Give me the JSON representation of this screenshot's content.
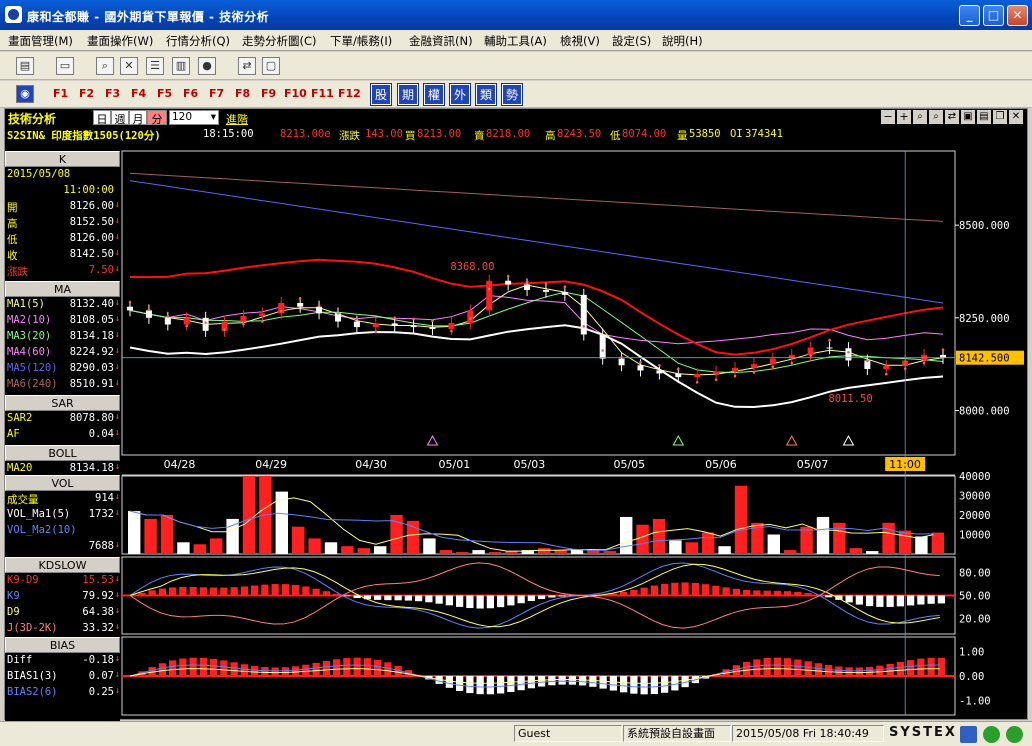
{
  "window": {
    "title": "康和全都賺 - 國外期貨下單報價 - 技術分析",
    "min_label": "_",
    "max_label": "□",
    "close_label": "✕"
  },
  "menu": [
    "畫面管理(M)",
    "畫面操作(W)",
    "行情分析(Q)",
    "走勢分析圖(C)",
    "下單/帳務(I)",
    "金融資訊(N)",
    "輔助工具(A)",
    "檢視(V)",
    "設定(S)",
    "說明(H)"
  ],
  "fkeys": [
    "F1",
    "F2",
    "F3",
    "F4",
    "F5",
    "F6",
    "F7",
    "F8",
    "F9",
    "F10",
    "F11",
    "F12"
  ],
  "quick": [
    "股",
    "期",
    "權",
    "外",
    "類",
    "勢"
  ],
  "chart_header": {
    "title": "技術分析",
    "period_tabs": [
      "日",
      "週",
      "月",
      "分"
    ],
    "period_value": "120",
    "advanced": "進階",
    "symbol": "S2SIN&  印度指數1505(120分)",
    "time": "18:15:00",
    "last": "8213.00e",
    "change_label": "漲跌",
    "change": "143.00",
    "bid_label": "買",
    "bid": "8213.00",
    "ask_label": "賣",
    "ask": "8218.00",
    "high_label": "高",
    "high": "8243.50",
    "low_label": "低",
    "low": "8074.00",
    "vol_label": "量",
    "vol": "53850",
    "oi_label": "OI",
    "oi": "374341"
  },
  "panel": {
    "k": {
      "label": "K",
      "date": "2015/05/08",
      "time": "11:00:00",
      "rows": [
        {
          "k": "開",
          "v": "8126.00",
          "c": "#ffff00"
        },
        {
          "k": "高",
          "v": "8152.50",
          "c": "#ffff00"
        },
        {
          "k": "低",
          "v": "8126.00",
          "c": "#ffff00"
        },
        {
          "k": "收",
          "v": "8142.50",
          "c": "#ffff00"
        },
        {
          "k": "漲跌",
          "v": "7.50",
          "c": "#ff3030"
        }
      ]
    },
    "ma": {
      "label": "MA",
      "rows": [
        {
          "k": "MA1(5)",
          "v": "8132.40",
          "c": "#ffff80"
        },
        {
          "k": "MA2(10)",
          "v": "8108.05",
          "c": "#ff80ff"
        },
        {
          "k": "MA3(20)",
          "v": "8134.18",
          "c": "#80ff80"
        },
        {
          "k": "MA4(60)",
          "v": "8224.92",
          "c": "#ff80ff"
        },
        {
          "k": "MA5(120)",
          "v": "8290.03",
          "c": "#6060ff"
        },
        {
          "k": "MA6(240)",
          "v": "8510.91",
          "c": "#b06060"
        }
      ]
    },
    "sar": {
      "label": "SAR",
      "rows": [
        {
          "k": "SAR2",
          "v": "8078.80",
          "c": "#ffff00"
        },
        {
          "k": "AF",
          "v": "0.04",
          "c": "#ffff00"
        }
      ]
    },
    "boll": {
      "label": "BOLL",
      "rows": [
        {
          "k": "MA20",
          "v": "8134.18",
          "c": "#ffff00"
        }
      ]
    },
    "vol": {
      "label": "VOL",
      "rows": [
        {
          "k": "成交量",
          "v": "914",
          "c": "#ffff00"
        },
        {
          "k": "VOL_Ma1(5)",
          "v": "1732",
          "c": "#ffffff"
        },
        {
          "k": "VOL_Ma2(10)",
          "v": "",
          "c": "#6080ff"
        },
        {
          "k": "",
          "v": "7688",
          "c": "#6080ff"
        }
      ]
    },
    "kd": {
      "label": "KDSLOW",
      "rows": [
        {
          "k": "K9-D9",
          "v": "15.53",
          "c": "#ff3030"
        },
        {
          "k": "K9",
          "v": "79.92",
          "c": "#6080ff"
        },
        {
          "k": "D9",
          "v": "64.38",
          "c": "#ffff60"
        },
        {
          "k": "J(3D-2K)",
          "v": "33.32",
          "c": "#ff8080"
        }
      ]
    },
    "bias": {
      "label": "BIAS",
      "rows": [
        {
          "k": "Diff",
          "v": "-0.18",
          "c": "#ffffff"
        },
        {
          "k": "BIAS1(3)",
          "v": "0.07",
          "c": "#ffffff"
        },
        {
          "k": "BIAS2(6)",
          "v": "0.25",
          "c": "#6080ff"
        }
      ]
    }
  },
  "chart_data": [
    {
      "type": "line",
      "panel": "price",
      "x": [
        "04/28",
        "04/29",
        "04/30",
        "05/01",
        "05/03",
        "05/05",
        "05/06",
        "05/07",
        "05/08 11:00"
      ],
      "yticks": [
        8000,
        8250,
        8500
      ],
      "ytick_labels": [
        "8000.000",
        "8250.000",
        "8500.000"
      ],
      "ylim": [
        7880,
        8700
      ],
      "last_price_label": "8142.500",
      "annotations": [
        {
          "text": "8368.00",
          "x_index": 18,
          "value": 8368
        },
        {
          "text": "8011.50",
          "x_index": 38,
          "value": 8011.5
        }
      ],
      "crosshair_label": "11:00",
      "candles_close": [
        8270,
        8250,
        8232,
        8250,
        8215,
        8240,
        8255,
        8262,
        8290,
        8280,
        8262,
        8240,
        8225,
        8235,
        8228,
        8225,
        8220,
        8236,
        8270,
        8350,
        8340,
        8325,
        8320,
        8312,
        8205,
        8140,
        8122,
        8108,
        8100,
        8090,
        8098,
        8105,
        8115,
        8125,
        8140,
        8150,
        8170,
        8168,
        8135,
        8112,
        8120,
        8135,
        8150,
        8142
      ],
      "series": [
        {
          "name": "MA6(240)",
          "values_start": 8640,
          "values_end": 8510
        },
        {
          "name": "MA5(120)",
          "values_start": 8620,
          "values_end": 8290
        },
        {
          "name": "MA4(60)",
          "values_start": 8270,
          "values_end": 8225
        },
        {
          "name": "BOLL",
          "values_start": 8420,
          "values_end": 8134
        }
      ]
    },
    {
      "type": "bar",
      "panel": "volume",
      "yticks": [
        10000,
        20000,
        30000,
        40000
      ],
      "ylim": [
        0,
        40000
      ],
      "values": [
        22000,
        18000,
        20000,
        6000,
        5000,
        8000,
        18000,
        40000,
        40000,
        32000,
        14000,
        8000,
        6000,
        4000,
        3000,
        4000,
        20000,
        17000,
        8000,
        2000,
        1000,
        2000,
        1000,
        1500,
        2000,
        3000,
        2000,
        2500,
        2000,
        1500,
        19000,
        15000,
        18000,
        7000,
        6000,
        11000,
        4000,
        35000,
        16000,
        10000,
        2000,
        14000,
        19000,
        16000,
        3000,
        1500,
        16000,
        12000,
        9000,
        11000
      ]
    },
    {
      "type": "bar",
      "panel": "kdslow",
      "yticks": [
        20,
        50,
        80
      ],
      "ylim": [
        0,
        100
      ]
    },
    {
      "type": "bar",
      "panel": "bias",
      "yticks": [
        -1.0,
        0.0,
        1.0
      ],
      "ylim": [
        -1.6,
        1.6
      ]
    }
  ],
  "status": {
    "user": "Guest",
    "layout": "系統預設自設畫面",
    "datetime": "2015/05/08 Fri 18:40:49",
    "brand": "SYSTEX"
  }
}
